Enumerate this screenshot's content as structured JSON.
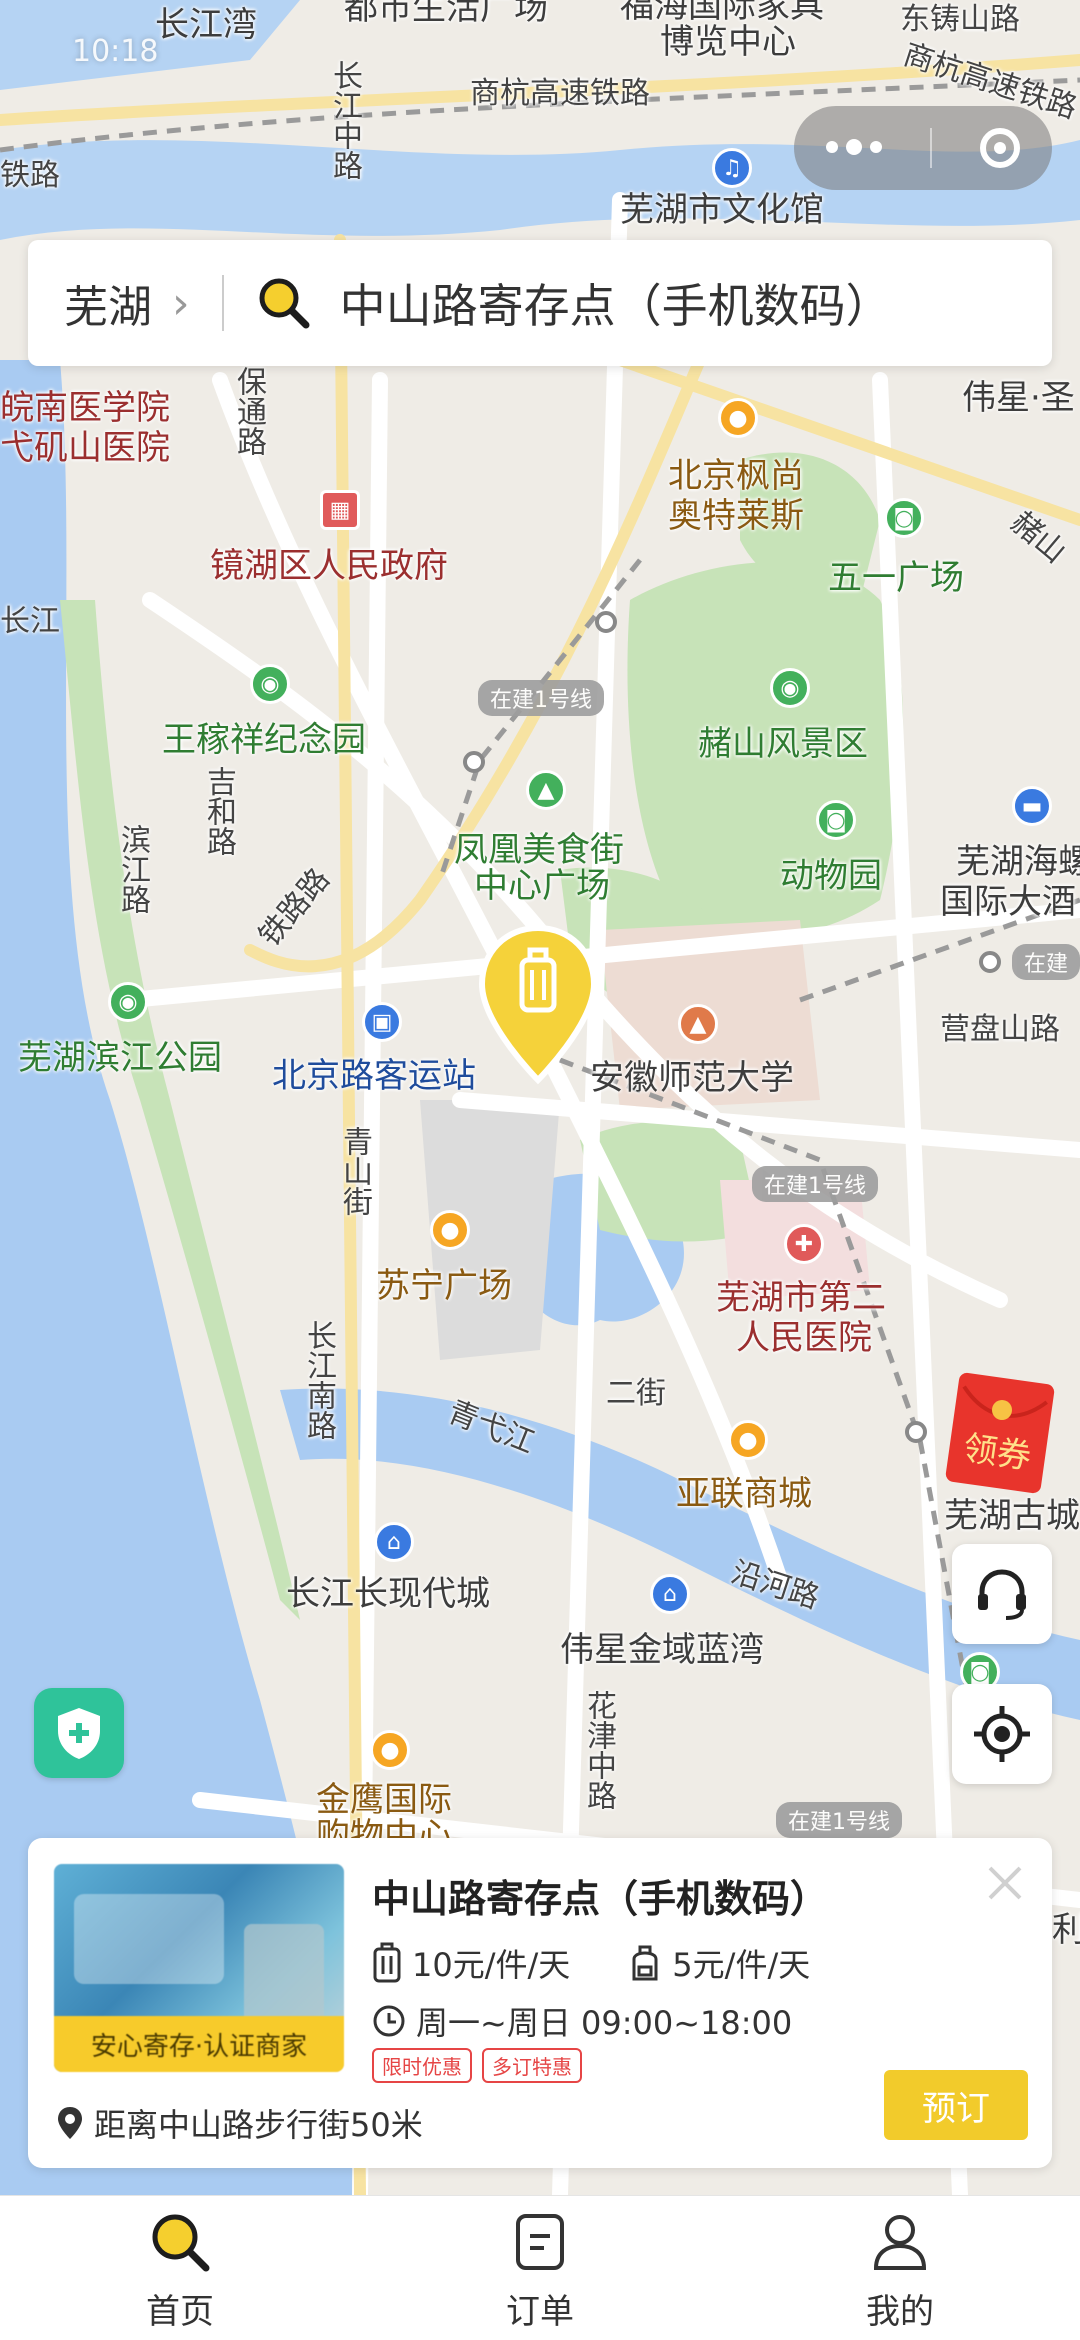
{
  "status_bar": {
    "time": "10:18"
  },
  "search": {
    "city": "芜湖",
    "query": "中山路寄存点（手机数码）"
  },
  "map": {
    "labels": {
      "changjiangwan": "长江湾",
      "dushi": "都市生活广场",
      "fuhai": "福海国际家具",
      "bolan": "博览中心",
      "shanghang": "商杭高速铁路",
      "shanghang2": "商杭高速铁路",
      "zhuoshan": "东铸山路",
      "changjiangzhong": "长江中路",
      "wenhuaguan": "芜湖市文化馆",
      "tielu": "铁路",
      "yixueyuan1": "皖南医学院",
      "yixueyuan2": "弋矶山医院",
      "baotong": "保通路",
      "weixing": "伟星·圣",
      "fengshang1": "北京枫尚",
      "fengshang2": "奥特莱斯",
      "jinghu": "镜湖区人民政府",
      "wuyi": "五一广场",
      "zheshan_road": "赭山",
      "changjiang": "长江",
      "zaijian1": "在建1号线",
      "wangjiaxiang": "王稼祥纪念园",
      "zheshan": "赭山风景区",
      "jihe": "吉和路",
      "binjiang_road": "滨江路",
      "fenghuang1": "凤凰美食街",
      "fenghuang2": "中心广场",
      "zoo": "动物园",
      "haiwan1": "芜湖海螺",
      "haiwan2": "国际大酒",
      "zaijian2": "在建",
      "tielu2": "铁路路",
      "yingpan": "营盘山路",
      "binjiang_park": "芜湖滨江公园",
      "beijinglu": "北京路客运站",
      "shida": "安徽师范大学",
      "qingshan": "青山街",
      "zaijian3": "在建1号线",
      "suning": "苏宁广场",
      "erhospital1": "芜湖市第二",
      "erhospital2": "人民医院",
      "erjie": "二街",
      "changjiangnan": "长江南路",
      "qingyi": "青弋江",
      "yalian": "亚联商城",
      "gucheng": "芜湖古城",
      "changxian": "长江长现代城",
      "yanhe": "沿河路",
      "jinyu": "伟星金域蓝湾",
      "huajin": "花津中路",
      "jinying1": "金鹰国际",
      "jinying2": "购物中心",
      "zaijian4": "在建1号线",
      "li": "利"
    }
  },
  "coupon": {
    "label": "领券"
  },
  "store_card": {
    "title": "中山路寄存点（手机数码）",
    "photo_badge": "安心寄存·认证商家",
    "price_large": "10元/件/天",
    "price_small": "5元/件/天",
    "hours": "周一~周日 09:00~18:00",
    "tags": [
      "限时优惠",
      "多订特惠"
    ],
    "distance": "距离中山路步行街50米",
    "book_label": "预订"
  },
  "tabbar": {
    "items": [
      {
        "label": "首页",
        "icon": "search-icon"
      },
      {
        "label": "订单",
        "icon": "order-icon"
      },
      {
        "label": "我的",
        "icon": "user-icon"
      }
    ]
  },
  "colors": {
    "accent": "#F2CB2B",
    "water": "#A9CBF2",
    "green": "#C7E3B8",
    "tag_red": "#E64545"
  }
}
